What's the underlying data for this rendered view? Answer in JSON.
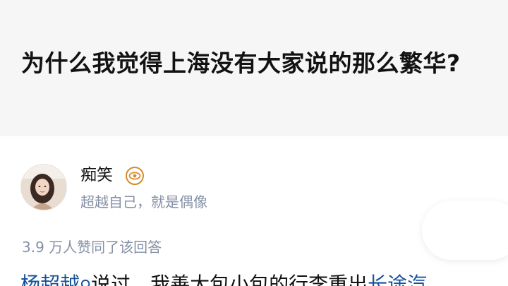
{
  "question": {
    "title": "为什么我觉得上海没有大家说的那么繁华?"
  },
  "answer": {
    "author": {
      "name": "痴笑",
      "bio": "超越自己，就是偶像",
      "avatar_icon": "avatar-photo",
      "badge_icon": "eye-badge-icon"
    },
    "vote_info": "3.9 万人赞同了该回答",
    "body": {
      "mention": "杨超越",
      "middle": "说过，我善大包小包的行李重出",
      "link": "长途汽"
    }
  },
  "colors": {
    "question_bg": "#f6f6f6",
    "title_text": "#121212",
    "meta_text": "#8590a6",
    "link": "#175199",
    "badge": "#d88b2b"
  }
}
